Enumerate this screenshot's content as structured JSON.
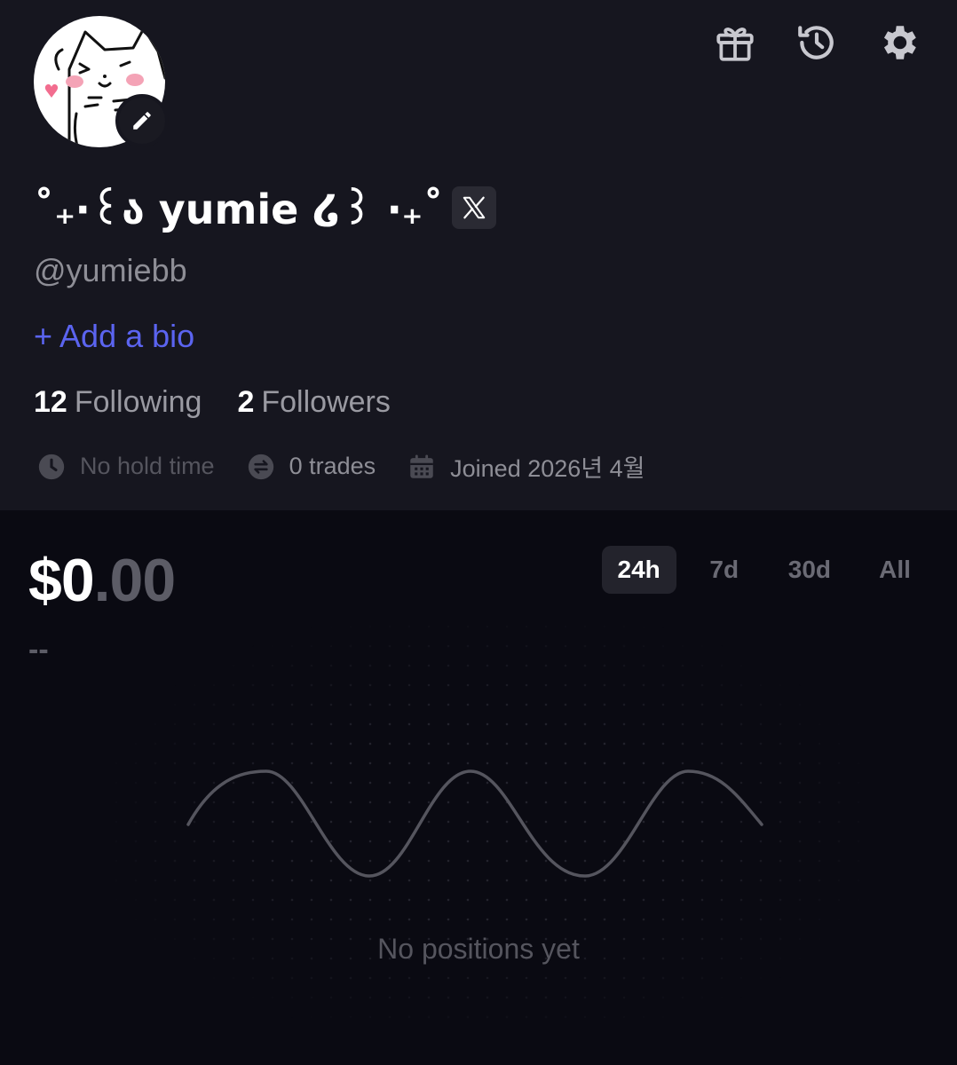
{
  "profile": {
    "display_name": "˚₊‧꒰ა yumie ໒꒱ ‧₊˚",
    "handle": "@yumiebb",
    "add_bio_label": "+ Add a bio",
    "following_count": "12",
    "following_label": "Following",
    "followers_count": "2",
    "followers_label": "Followers",
    "hold_time": "No hold time",
    "trades": "0 trades",
    "joined": "Joined 2026년 4월",
    "social_badge": "X"
  },
  "toolbar": {
    "icons": [
      "gift-icon",
      "history-icon",
      "settings-icon"
    ]
  },
  "portfolio": {
    "balance_main": "$0",
    "balance_cents": ".00",
    "change": "--",
    "ranges": [
      "24h",
      "7d",
      "30d",
      "All"
    ],
    "active_range": "24h",
    "empty_message": "No positions yet"
  },
  "colors": {
    "accent": "#5b64f0",
    "header_bg": "#16161f",
    "page_bg": "#0a0a12"
  }
}
